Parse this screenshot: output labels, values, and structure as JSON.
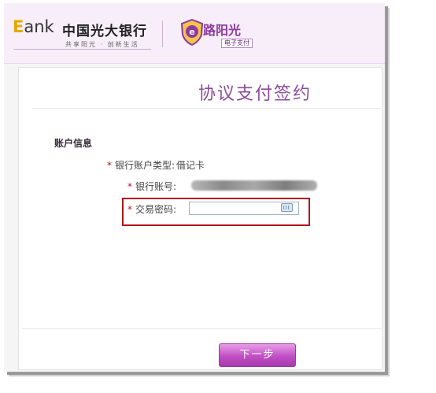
{
  "header": {
    "ebank_e": "E",
    "ebank_rest": "ank",
    "bank_name": "中国光大银行",
    "slogan": "共享阳光 · 创新生活",
    "brand_name": "路阳光",
    "brand_sub": "电子支付",
    "logo_icon": "e-shield-icon"
  },
  "page": {
    "title": "协议支付签约"
  },
  "account": {
    "section_title": "账户信息",
    "required_mark": "*",
    "type_label": "银行账户类型:",
    "type_value": "借记卡",
    "number_label": "银行账号:",
    "password_label": "交易密码:",
    "password_value": "",
    "keyboard_icon": "keyboard-icon"
  },
  "actions": {
    "next_label": "下一步"
  },
  "colors": {
    "header_bg": "#f7eef9",
    "title": "#8a4c98",
    "required": "#c0101a",
    "highlight_border": "#b3141c",
    "button": "#c04fc4"
  }
}
